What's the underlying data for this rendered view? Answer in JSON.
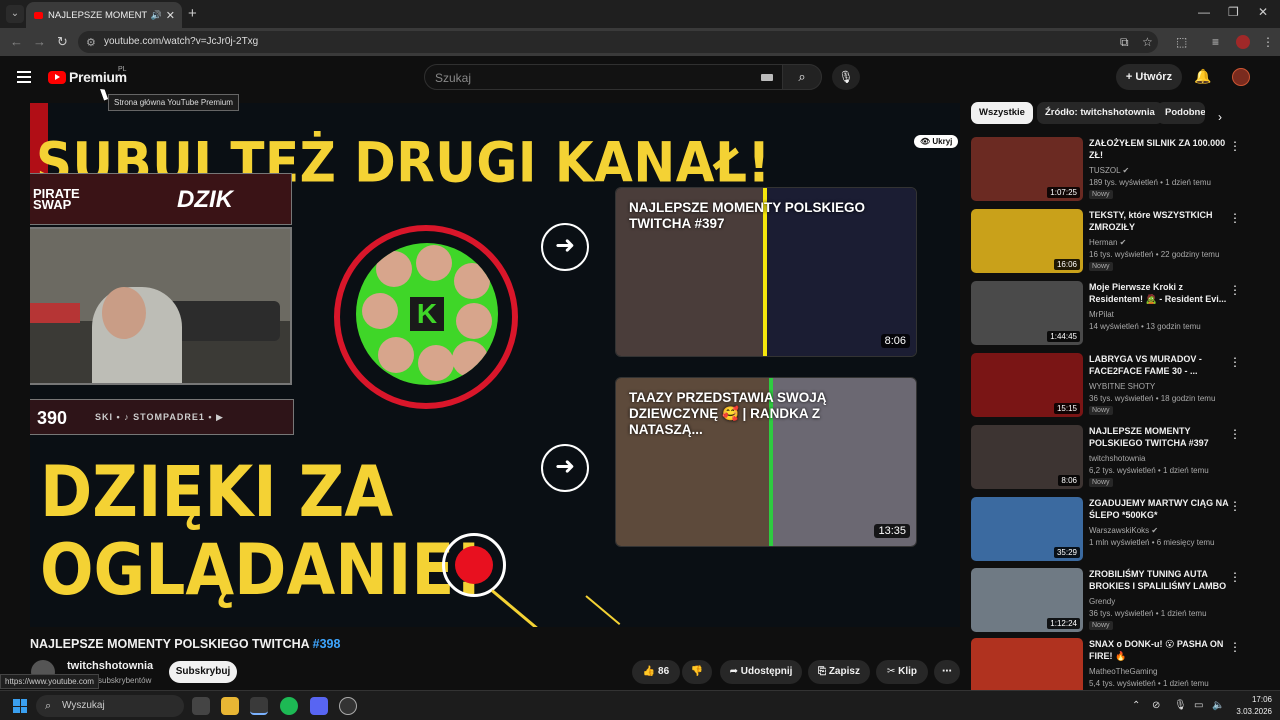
{
  "browser": {
    "tab_title": "NAJLEPSZE MOMENTY POL",
    "url": "youtube.com/watch?v=JcJr0j-2Txg",
    "status_url": "https://www.youtube.com"
  },
  "header": {
    "brand": "Premium",
    "region": "PL",
    "logo_tooltip": "Strona główna YouTube Premium",
    "search_placeholder": "Szukaj",
    "create_label": "Utwórz"
  },
  "player": {
    "headline": "SUBUJ TEŻ DRUGI KANAŁ!",
    "outro_line1": "DZIĘKI ZA",
    "outro_line2": "OGLĄDANIE!",
    "hide_label": "Ukryj",
    "overlay_logo1_line1": "PIRATE",
    "overlay_logo1_line2": "SWAP",
    "overlay_logo2": "DZIK",
    "overlay_counter": "390",
    "overlay_ticker": "SKI • ♪ STOMPADRE1 • ▶",
    "endcards": [
      {
        "title": "NAJLEPSZE MOMENTY POLSKIEGO TWITCHA #397",
        "duration": "8:06"
      },
      {
        "title": "TAAZY PRZEDSTAWIA SWOJĄ DZIEWCZYNĘ 🥰 | RANDKA Z NATASZĄ...",
        "duration": "13:35"
      }
    ]
  },
  "video": {
    "title_main": "NAJLEPSZE MOMENTY POLSKIEGO TWITCHA ",
    "title_tag": "#398",
    "channel": "twitchshotownia",
    "subscribers": "subskrybentów",
    "subscribe_label": "Subskrybuj",
    "likes": "86",
    "share_label": "Udostępnij",
    "save_label": "Zapisz",
    "clip_label": "Klip"
  },
  "chips": [
    "Wszystkie",
    "Źródło: twitchshotownia",
    "Podobne"
  ],
  "recommendations": [
    {
      "title": "ZAŁOŻYŁEM SILNIK ZA 100.000 ZŁ!",
      "channel": "TUSZOL ✔",
      "meta": "189 tys. wyświetleń • 1 dzień temu",
      "badge": "Nowy",
      "duration": "1:07:25",
      "color": "#6b2a22"
    },
    {
      "title": "TEKSTY, które WSZYSTKICH ZMROZIŁY",
      "channel": "Herman ✔",
      "meta": "16 tys. wyświetleń • 22 godziny temu",
      "badge": "Nowy",
      "duration": "16:06",
      "color": "#c9a11a"
    },
    {
      "title": "Moje Pierwsze Kroki z Residentem! 🧟 - Resident Evi...",
      "channel": "MrPilat",
      "meta": "14 wyświetleń • 13 godzin temu",
      "badge": "",
      "duration": "1:44:45",
      "color": "#4a4a4a"
    },
    {
      "title": "LABRYGA VS MURADOV - FACE2FACE FAME 30 - ...",
      "channel": "WYBITNE SHOTY",
      "meta": "36 tys. wyświetleń • 18 godzin temu",
      "badge": "Nowy",
      "duration": "15:15",
      "color": "#7a1515"
    },
    {
      "title": "NAJLEPSZE MOMENTY POLSKIEGO TWITCHA #397",
      "channel": "twitchshotownia",
      "meta": "6,2 tys. wyświetleń • 1 dzień temu",
      "badge": "Nowy",
      "duration": "8:06",
      "color": "#3d3432"
    },
    {
      "title": "ZGADUJEMY MARTWY CIĄG NA ŚLEPO *500KG*",
      "channel": "WarszawskiKoks ✔",
      "meta": "1 mln wyświetleń • 6 miesięcy temu",
      "badge": "",
      "duration": "35:29",
      "color": "#3b6aa0"
    },
    {
      "title": "ZROBILIŚMY TUNING AUTA BROKIES I SPALILIŚMY LAMBO",
      "channel": "Grendy",
      "meta": "36 tys. wyświetleń • 1 dzień temu",
      "badge": "Nowy",
      "duration": "1:12:24",
      "color": "#6f7a84"
    },
    {
      "title": "SNAX o DONK-u! 😮 PASHA ON FIRE! 🔥",
      "channel": "MatheoTheGaming",
      "meta": "5,4 tys. wyświetleń • 1 dzień temu",
      "badge": "",
      "duration": "",
      "color": "#b0321f"
    }
  ],
  "taskbar": {
    "search_label": "Wyszukaj",
    "time": "17:06",
    "date": "3.03.2026"
  },
  "colors": {
    "accent_red": "#ff0000",
    "headline_yellow": "#f4d234",
    "link_blue": "#3ea6ff"
  }
}
